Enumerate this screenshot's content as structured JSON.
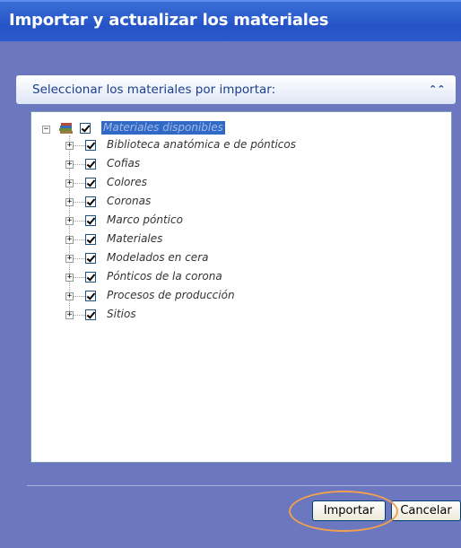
{
  "window": {
    "title": "Importar y actualizar los materiales"
  },
  "section": {
    "label": "Seleccionar los materiales por importar:",
    "collapse_icon": "double-chevron-up-icon"
  },
  "tree": {
    "root": {
      "label": "Materiales disponibles",
      "checked": true,
      "expanded": true,
      "icon": "books-icon"
    },
    "items": [
      {
        "label": "Biblioteca anatómica e de pónticos",
        "checked": true
      },
      {
        "label": "Cofias",
        "checked": true
      },
      {
        "label": "Colores",
        "checked": true
      },
      {
        "label": "Coronas",
        "checked": true
      },
      {
        "label": "Marco póntico",
        "checked": true
      },
      {
        "label": "Materiales",
        "checked": true
      },
      {
        "label": "Modelados en cera",
        "checked": true
      },
      {
        "label": "Pónticos de la corona",
        "checked": true
      },
      {
        "label": "Procesos de producción",
        "checked": true
      },
      {
        "label": "Sitios",
        "checked": true
      }
    ]
  },
  "buttons": {
    "import_label": "Importar",
    "cancel_label": "Cancelar"
  },
  "colors": {
    "titlebar": "#2554c7",
    "background": "#6b77bf",
    "highlight_ring": "#f0a050"
  }
}
